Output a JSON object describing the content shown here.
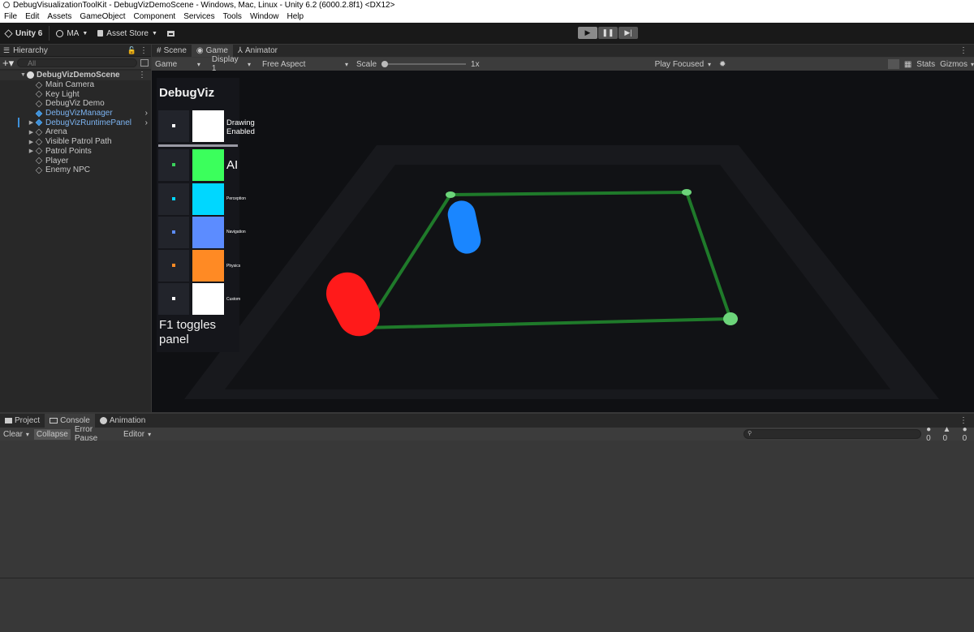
{
  "window": {
    "title": "DebugVisualizationToolKit - DebugVizDemoScene - Windows, Mac, Linux - Unity 6.2 (6000.2.8f1) <DX12>"
  },
  "menu": [
    "File",
    "Edit",
    "Assets",
    "GameObject",
    "Component",
    "Services",
    "Tools",
    "Window",
    "Help"
  ],
  "toolbar": {
    "unity_label": "Unity 6",
    "account_label": "MA",
    "asset_store_label": "Asset Store"
  },
  "hierarchy": {
    "tab_label": "Hierarchy",
    "search_placeholder": "All",
    "scene_name": "DebugVizDemoScene",
    "items": [
      {
        "label": "Main Camera"
      },
      {
        "label": "Key Light"
      },
      {
        "label": "DebugViz Demo"
      },
      {
        "label": "DebugVizManager"
      },
      {
        "label": "DebugVizRuntimePanel"
      },
      {
        "label": "Arena"
      },
      {
        "label": "Visible Patrol Path"
      },
      {
        "label": "Patrol Points"
      },
      {
        "label": "Player"
      },
      {
        "label": "Enemy NPC"
      }
    ]
  },
  "view_tabs": {
    "scene": "Scene",
    "game": "Game",
    "animator": "Animator"
  },
  "game_toolbar": {
    "mode": "Game",
    "display": "Display 1",
    "aspect": "Free Aspect",
    "scale_label": "Scale",
    "scale_value": "1x",
    "play_mode": "Play Focused",
    "stats": "Stats",
    "gizmos": "Gizmos"
  },
  "debug_panel": {
    "title": "DebugViz",
    "drawing_enabled": "Drawing\nEnabled",
    "rows": [
      {
        "label": "AI",
        "color": "#3bff5c",
        "dot": "#3bd35c"
      },
      {
        "label": "Perception",
        "color": "#00d7ff",
        "dot": "#00d7ff"
      },
      {
        "label": "Navigation",
        "color": "#5c8cff",
        "dot": "#5c8cff"
      },
      {
        "label": "Physics",
        "color": "#ff8a24",
        "dot": "#ff8a24"
      },
      {
        "label": "Custom",
        "color": "#ffffff",
        "dot": "#ffffff"
      }
    ],
    "footer": "F1 toggles panel"
  },
  "bottom_tabs": {
    "project": "Project",
    "console": "Console",
    "animation": "Animation"
  },
  "console_toolbar": {
    "clear": "Clear",
    "collapse": "Collapse",
    "error_pause": "Error Pause",
    "editor": "Editor",
    "log_count": "0",
    "warn_count": "0",
    "error_count": "0"
  }
}
